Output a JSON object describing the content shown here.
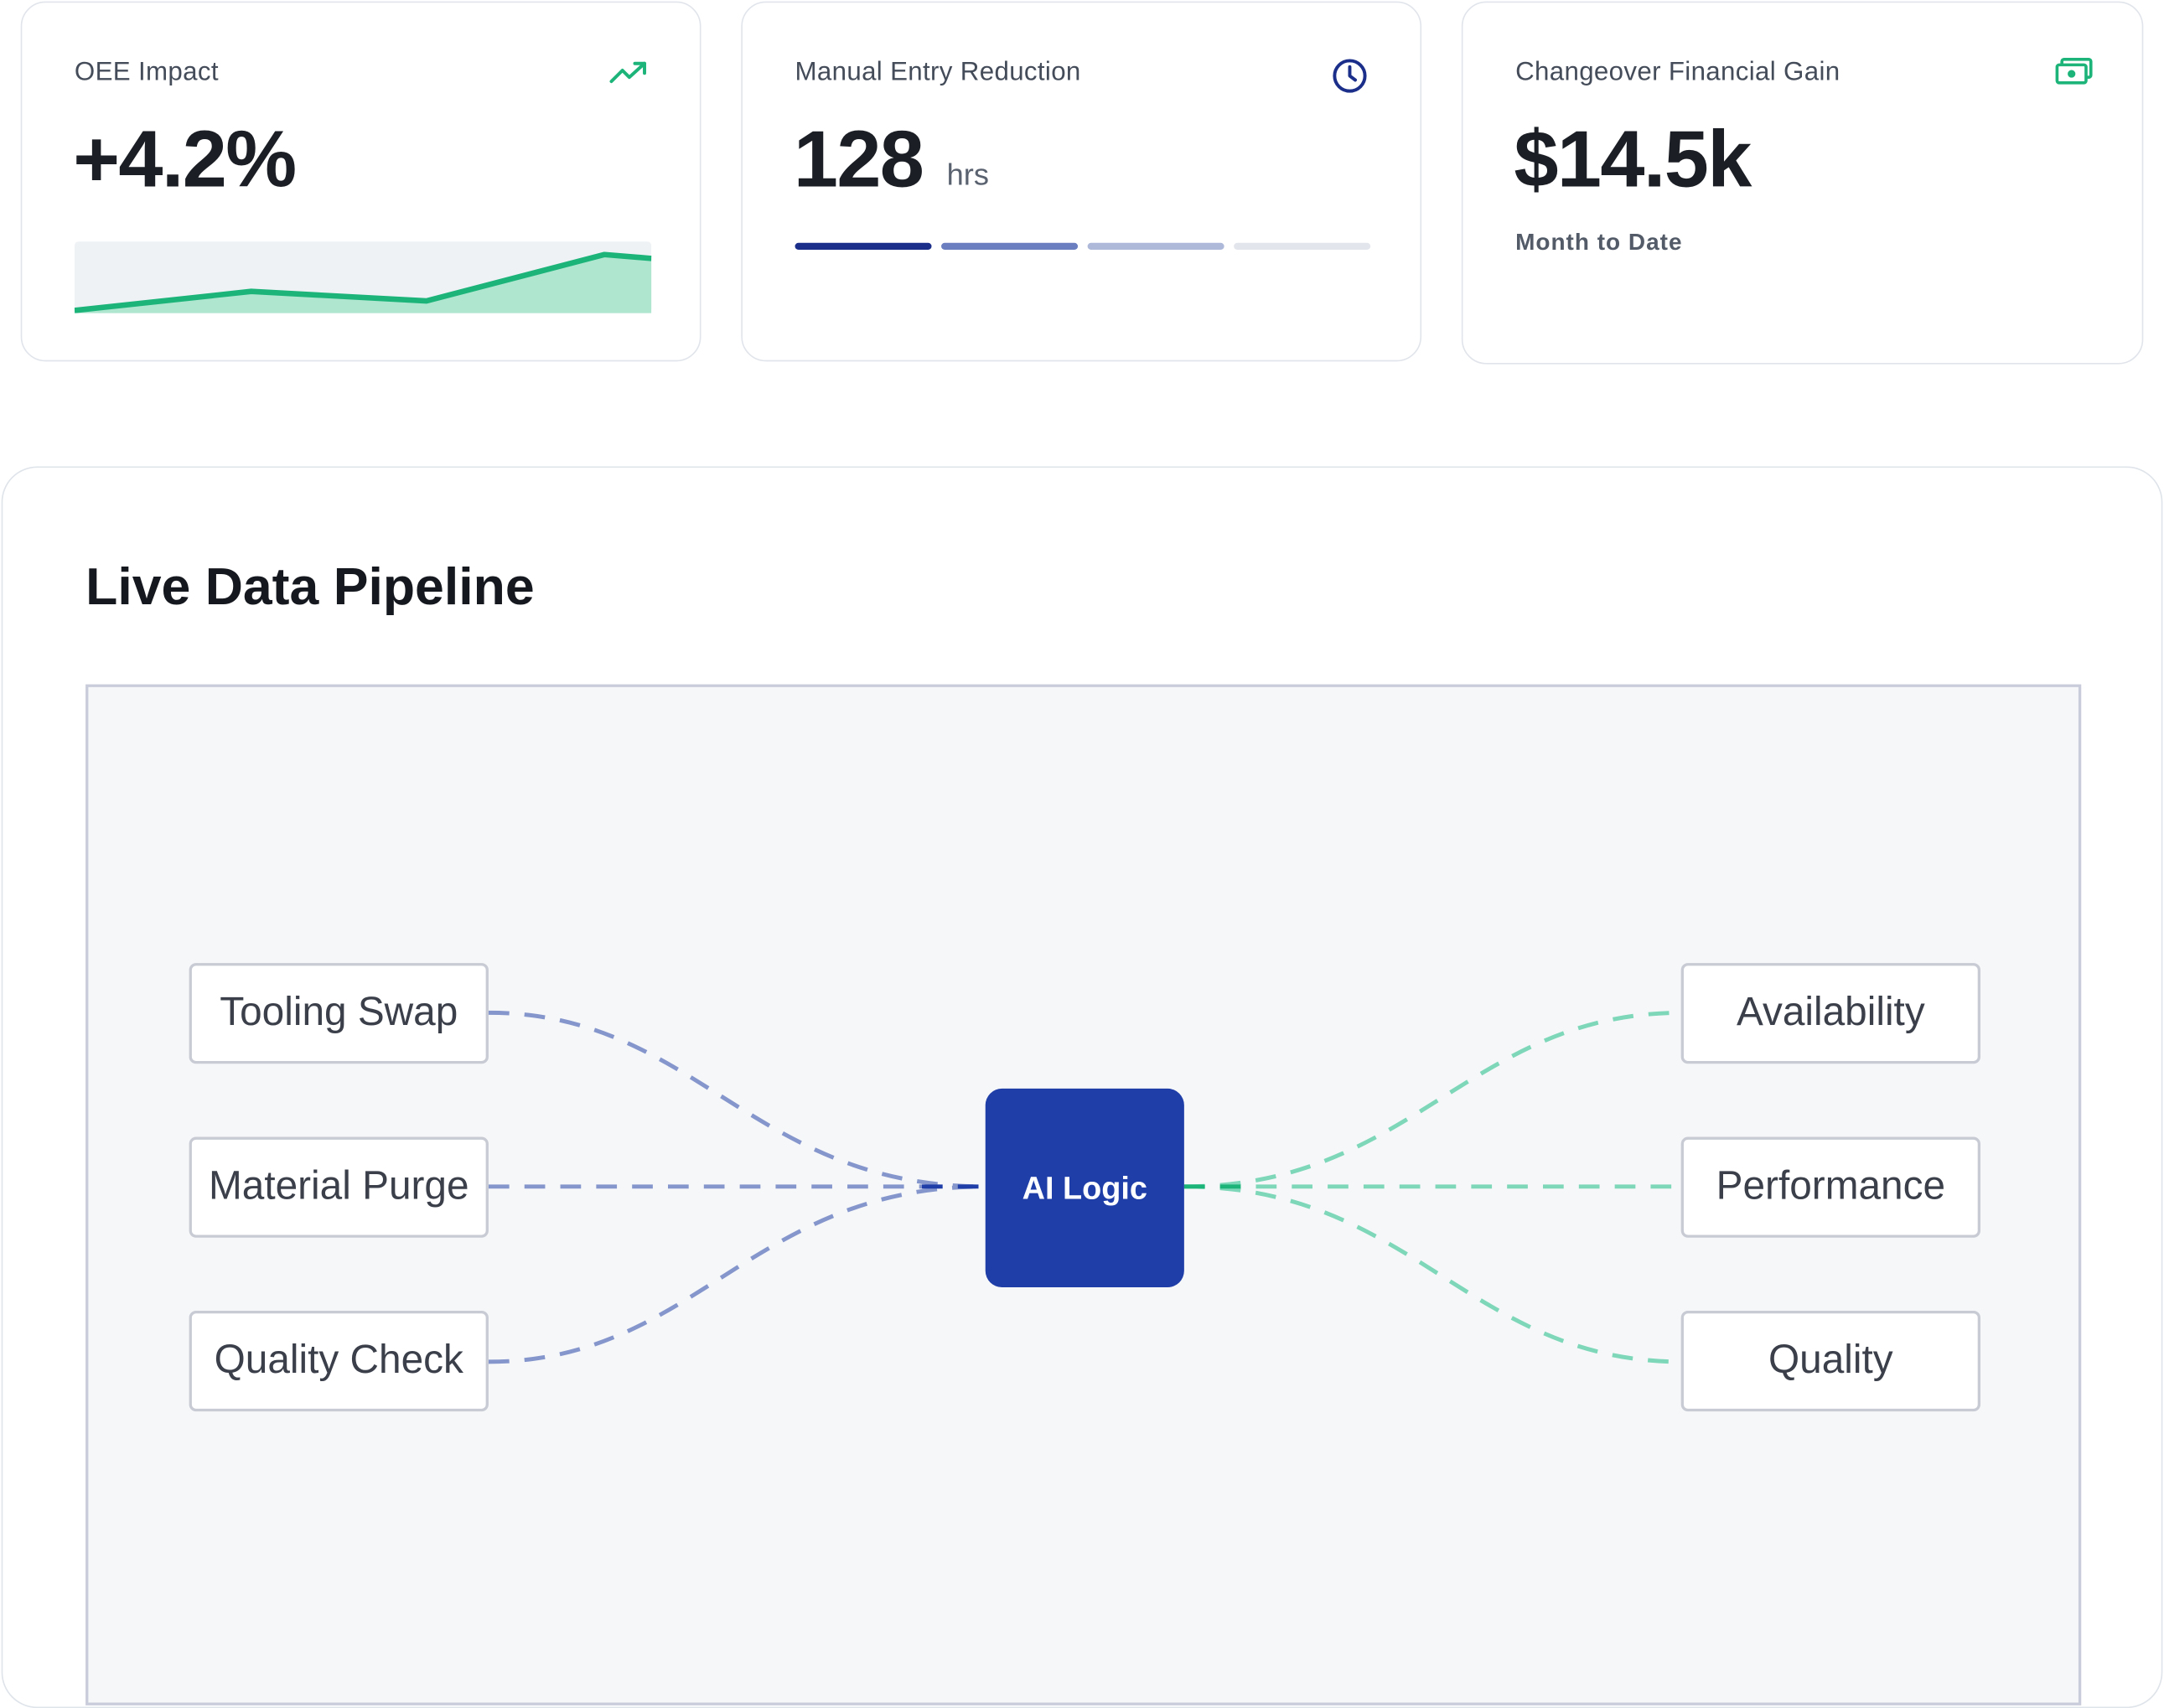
{
  "cards": {
    "oee": {
      "label": "OEE Impact",
      "value": "+4.2%",
      "icon": "trending-up-icon",
      "trend": [
        0.0,
        0.3,
        0.15,
        0.88,
        0.82
      ]
    },
    "manual": {
      "label": "Manual Entry Reduction",
      "value": "128",
      "unit": "hrs",
      "icon": "clock-icon",
      "progress_segments": 4
    },
    "changeover": {
      "label": "Changeover Financial Gain",
      "value": "$14.5k",
      "sub": "Month to Date",
      "icon": "cash-icon"
    }
  },
  "pipeline": {
    "title": "Live Data Pipeline",
    "inputs": [
      "Tooling Swap",
      "Material Purge",
      "Quality Check"
    ],
    "hub": "AI Logic",
    "outputs": [
      "Availability",
      "Performance",
      "Quality"
    ]
  },
  "colors": {
    "accent_green": "#1db47a",
    "accent_blue": "#1f3ea8",
    "input_wire": "#8596cc",
    "output_wire": "#7dd7b8"
  }
}
